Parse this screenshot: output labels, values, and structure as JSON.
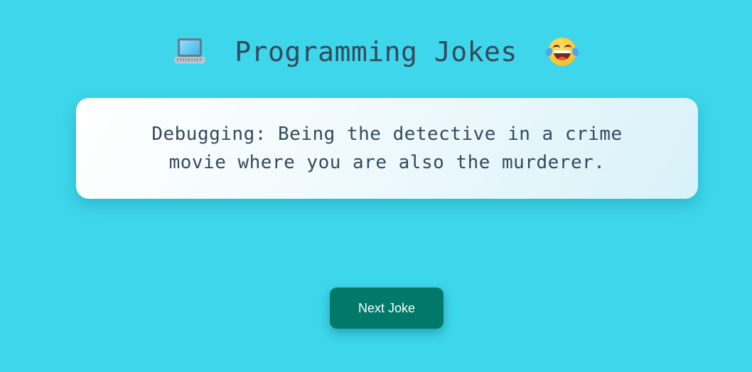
{
  "header": {
    "title": "Programming Jokes",
    "left_icon": "laptop-icon",
    "right_icon": "laughing-tears-icon"
  },
  "joke": {
    "text": "Debugging: Being the detective in a crime movie where you are also the murderer."
  },
  "actions": {
    "next_label": "Next Joke"
  },
  "colors": {
    "background": "#3dd6ea",
    "title_text": "#34495e",
    "card_background": "#ffffff",
    "button_background": "#00796b",
    "button_text": "#ffffff"
  }
}
